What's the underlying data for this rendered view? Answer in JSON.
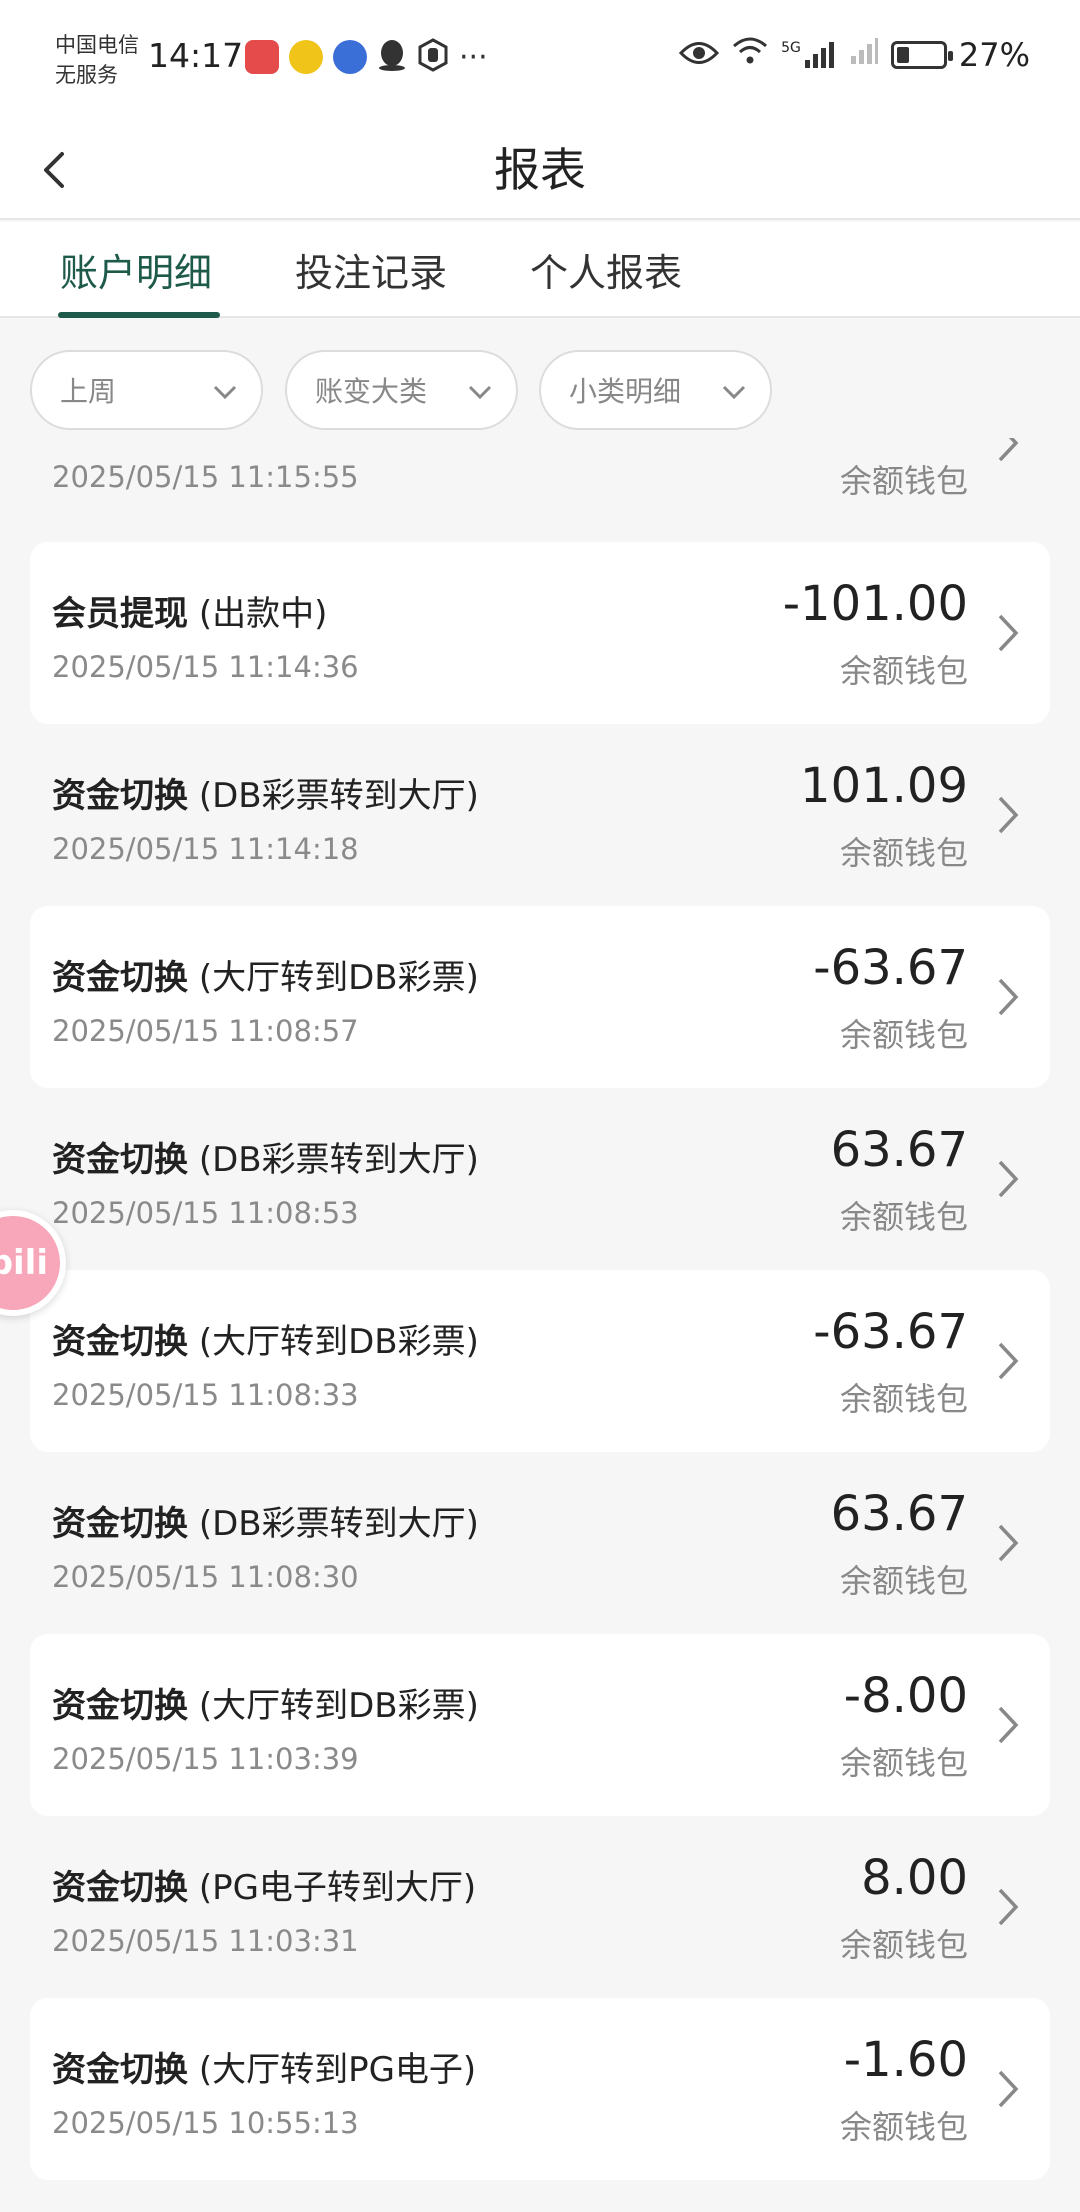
{
  "status_bar": {
    "carrier_line1": "中国电信",
    "carrier_line2": "无服务",
    "time": "14:17",
    "more": "···",
    "signal_label": "5G",
    "battery_percent": "27%",
    "battery_level": 0.27
  },
  "header": {
    "title": "报表"
  },
  "tabs": [
    {
      "label": "账户明细",
      "active": true
    },
    {
      "label": "投注记录",
      "active": false
    },
    {
      "label": "个人报表",
      "active": false
    }
  ],
  "filters": [
    {
      "label": "上周"
    },
    {
      "label": "账变大类"
    },
    {
      "label": "小类明细"
    }
  ],
  "floating_badge": {
    "label": "bili"
  },
  "rows": [
    {
      "category": "",
      "detail": "",
      "time": "2025/05/15 11:15:55",
      "amount": "",
      "wallet": "余额钱包"
    },
    {
      "category": "会员提现",
      "detail": "(出款中)",
      "time": "2025/05/15 11:14:36",
      "amount": "-101.00",
      "wallet": "余额钱包"
    },
    {
      "category": "资金切换",
      "detail": "(DB彩票转到大厅)",
      "time": "2025/05/15 11:14:18",
      "amount": "101.09",
      "wallet": "余额钱包"
    },
    {
      "category": "资金切换",
      "detail": "(大厅转到DB彩票)",
      "time": "2025/05/15 11:08:57",
      "amount": "-63.67",
      "wallet": "余额钱包"
    },
    {
      "category": "资金切换",
      "detail": "(DB彩票转到大厅)",
      "time": "2025/05/15 11:08:53",
      "amount": "63.67",
      "wallet": "余额钱包"
    },
    {
      "category": "资金切换",
      "detail": "(大厅转到DB彩票)",
      "time": "2025/05/15 11:08:33",
      "amount": "-63.67",
      "wallet": "余额钱包"
    },
    {
      "category": "资金切换",
      "detail": "(DB彩票转到大厅)",
      "time": "2025/05/15 11:08:30",
      "amount": "63.67",
      "wallet": "余额钱包"
    },
    {
      "category": "资金切换",
      "detail": "(大厅转到DB彩票)",
      "time": "2025/05/15 11:03:39",
      "amount": "-8.00",
      "wallet": "余额钱包"
    },
    {
      "category": "资金切换",
      "detail": "(PG电子转到大厅)",
      "time": "2025/05/15 11:03:31",
      "amount": "8.00",
      "wallet": "余额钱包"
    },
    {
      "category": "资金切换",
      "detail": "(大厅转到PG电子)",
      "time": "2025/05/15 10:55:13",
      "amount": "-1.60",
      "wallet": "余额钱包"
    }
  ]
}
